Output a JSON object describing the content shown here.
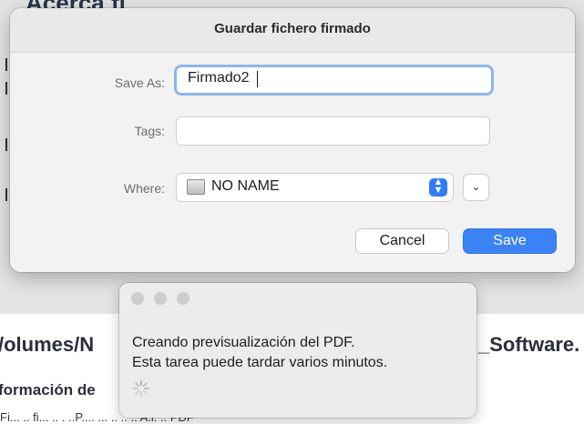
{
  "background": {
    "heading_top": "Acerca fi",
    "path_left": "/olumes/N",
    "path_right": "_Software.",
    "subheading": "formación de",
    "bottom_text": "Fi... .. fi... .. . ..P.... ... .. .. .. A.l. .. PDF"
  },
  "save_dialog": {
    "title": "Guardar fichero firmado",
    "save_as_label": "Save As:",
    "save_as_value": "Firmado2",
    "tags_label": "Tags:",
    "tags_value": "",
    "where_label": "Where:",
    "where_value": "NO NAME",
    "where_icon": "drive-icon",
    "cancel_label": "Cancel",
    "save_label": "Save",
    "accent_color": "#3b82f6"
  },
  "progress_popup": {
    "line1": "Creando previsualización del PDF.",
    "line2": "Esta tarea puede tardar varios minutos."
  }
}
